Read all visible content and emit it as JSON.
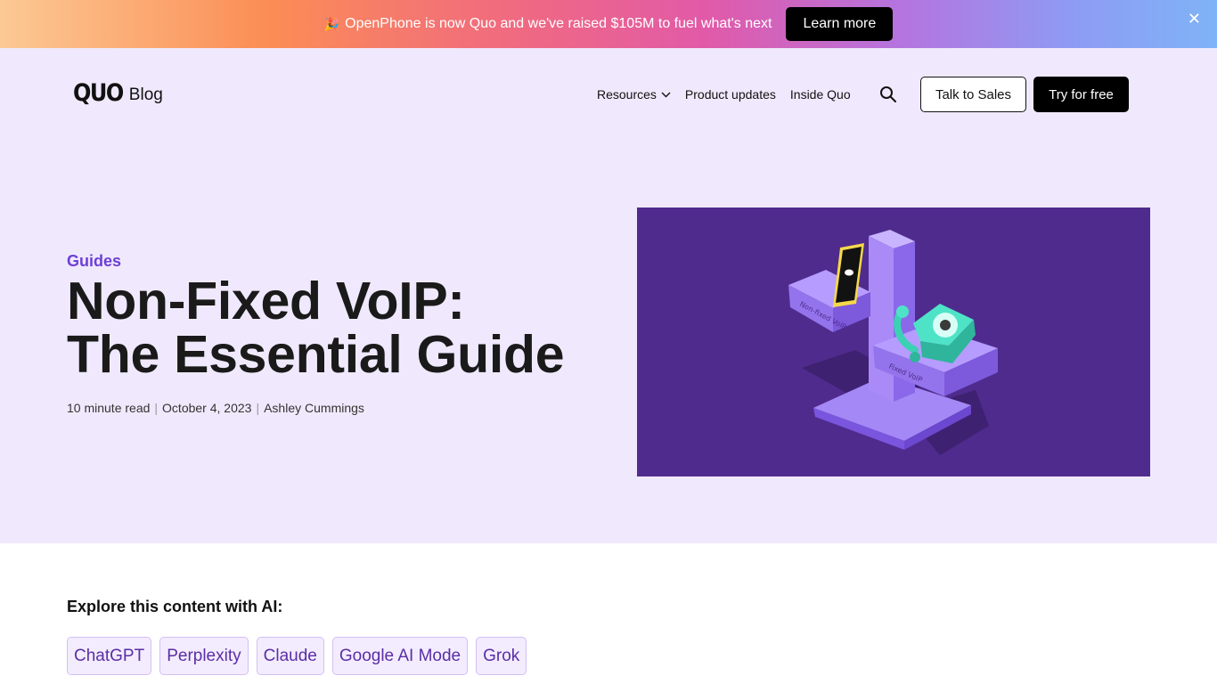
{
  "announcement": {
    "icon": "party-popper-icon",
    "text": "OpenPhone is now Quo and we've raised $105M to fuel what's next",
    "cta_label": "Learn more",
    "close_icon": "close-icon"
  },
  "header": {
    "logo_text": "QUO",
    "logo_suffix": "Blog",
    "nav": {
      "resources": "Resources",
      "product_updates": "Product updates",
      "inside_quo": "Inside Quo"
    },
    "talk_to_sales": "Talk to Sales",
    "try_for_free": "Try for free"
  },
  "article": {
    "category": "Guides",
    "title_line1": "Non-Fixed VoIP:",
    "title_line2": "The Essential Guide",
    "read_time": "10 minute read",
    "date": "October 4, 2023",
    "author": "Ashley Cummings",
    "image_labels": {
      "left_tray": "Non-fixed VoIP",
      "right_tray": "Fixed VoIP"
    }
  },
  "explore": {
    "title": "Explore this content with AI:",
    "options": [
      "ChatGPT",
      "Perplexity",
      "Claude",
      "Google AI Mode",
      "Grok"
    ]
  },
  "colors": {
    "hero_bg": "#f0e9fd",
    "accent": "#6d3fd6",
    "image_bg": "#4f2b8d"
  }
}
